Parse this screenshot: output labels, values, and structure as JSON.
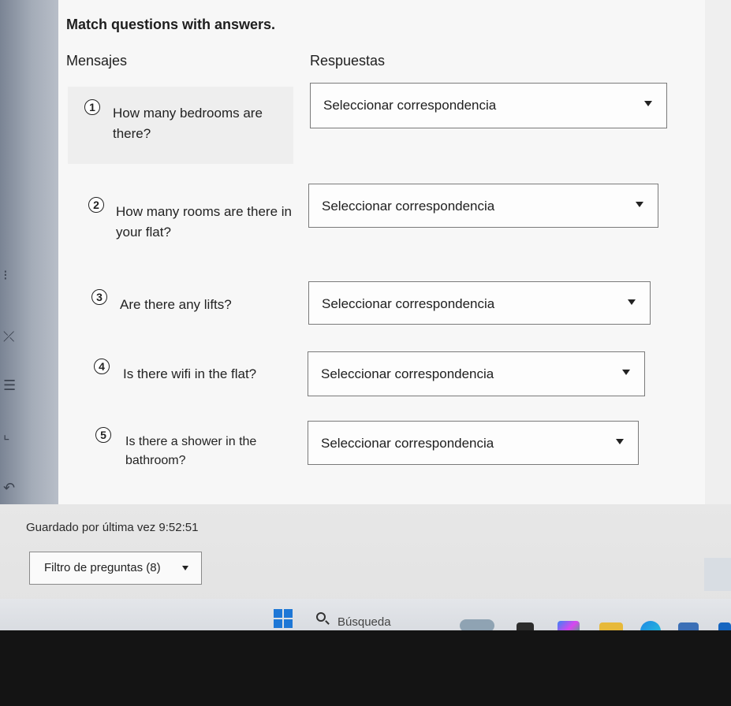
{
  "quiz": {
    "instruction": "Match questions with answers.",
    "columns": {
      "messages": "Mensajes",
      "answers": "Respuestas"
    },
    "questions": [
      {
        "number": "1",
        "text": "How many bedrooms are there?",
        "select_label": "Seleccionar correspondencia"
      },
      {
        "number": "2",
        "text": "How many rooms are there in your flat?",
        "select_label": "Seleccionar correspondencia"
      },
      {
        "number": "3",
        "text": "Are there any lifts?",
        "select_label": "Seleccionar correspondencia"
      },
      {
        "number": "4",
        "text": "Is there wifi in the flat?",
        "select_label": "Seleccionar correspondencia"
      },
      {
        "number": "5",
        "text": "Is there a shower in the bathroom?",
        "select_label": "Seleccionar correspondencia"
      }
    ]
  },
  "footer": {
    "saved_text": "Guardado por última vez 9:52:51",
    "filter_label": "Filtro de preguntas (8)"
  },
  "taskbar": {
    "search_label": "Búsqueda",
    "start_icon": "windows-start-icon",
    "accent_color": "#1e77d6"
  }
}
